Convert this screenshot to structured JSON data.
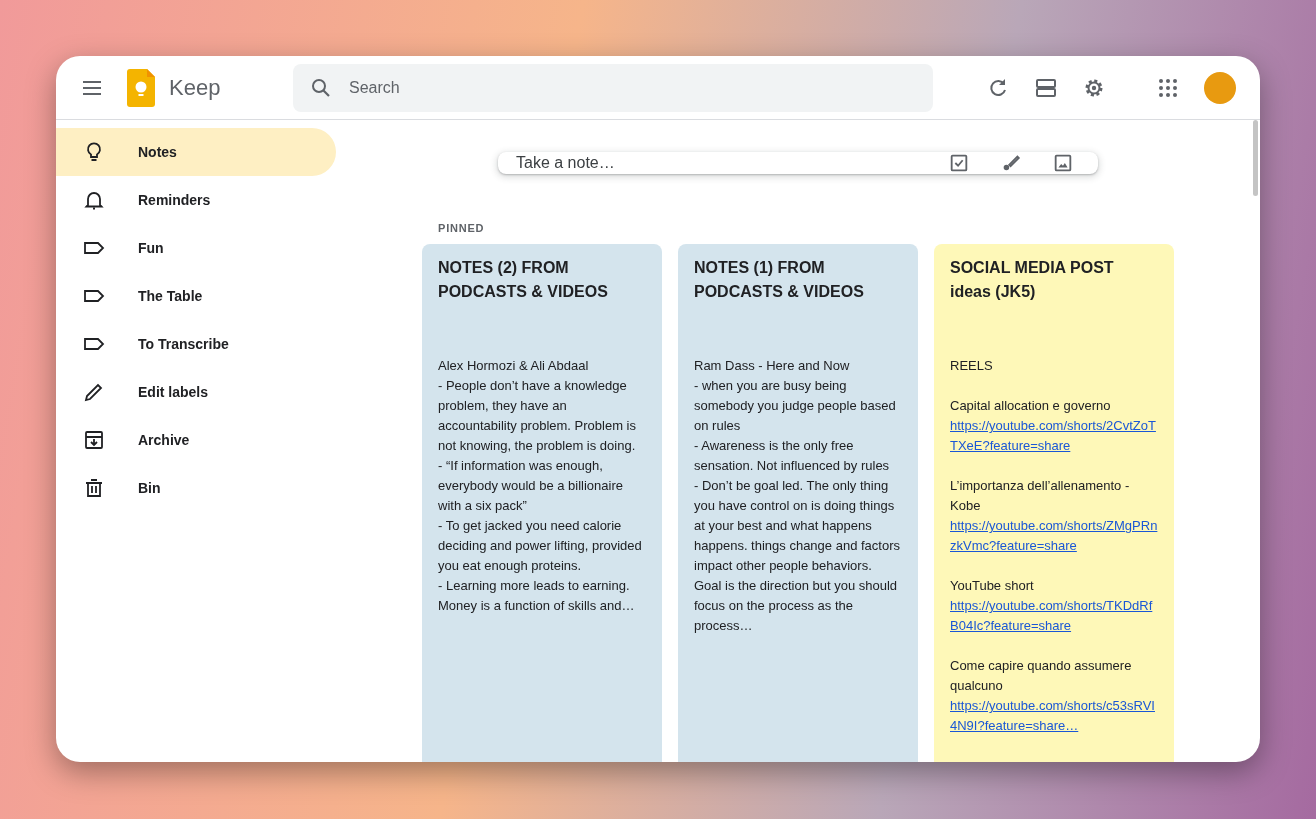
{
  "header": {
    "app_name": "Keep",
    "search": {
      "placeholder": "Search"
    }
  },
  "sidebar": {
    "items": [
      {
        "label": "Notes",
        "kind": "bulb",
        "selected": true
      },
      {
        "label": "Reminders",
        "kind": "bell",
        "selected": false
      },
      {
        "label": "Fun",
        "kind": "label",
        "selected": false
      },
      {
        "label": "The Table",
        "kind": "label",
        "selected": false
      },
      {
        "label": "To Transcribe",
        "kind": "label",
        "selected": false
      },
      {
        "label": "Edit labels",
        "kind": "pencil",
        "selected": false
      },
      {
        "label": "Archive",
        "kind": "archive",
        "selected": false
      },
      {
        "label": "Bin",
        "kind": "trash",
        "selected": false
      }
    ]
  },
  "take_note": {
    "placeholder": "Take a note…"
  },
  "pinned_label": "PINNED",
  "notes": [
    {
      "title": "NOTES (2) FROM PODCASTS & VIDEOS",
      "color": "#d4e4ed",
      "sections": [
        [
          {
            "kind": "text",
            "text": "Alex Hormozi & Ali Abdaal"
          },
          {
            "kind": "text",
            "text": "- People don’t have a knowledge problem, they have an accountability problem. Problem is not knowing, the problem is doing."
          },
          {
            "kind": "text",
            "text": "- “If information  was enough, everybody would be a billionaire with a six pack”"
          },
          {
            "kind": "text",
            "text": "- To get jacked you need calorie deciding and power lifting, provided you eat enough proteins."
          },
          {
            "kind": "text",
            "text": "- Learning more leads to earning. Money is a function of skills and…"
          }
        ]
      ]
    },
    {
      "title": "NOTES (1) FROM PODCASTS & VIDEOS",
      "color": "#d4e4ed",
      "sections": [
        [
          {
            "kind": "text",
            "text": "Ram Dass - Here and Now"
          },
          {
            "kind": "text",
            "text": "- when you are busy being somebody you judge people based on rules"
          },
          {
            "kind": "text",
            "text": "- Awareness is the only free sensation. Not influenced by rules"
          },
          {
            "kind": "text",
            "text": "- Don’t be goal led. The only thing you have control on is doing things at your best and what happens happens. things change and factors impact other people behaviors. Goal is the direction but you should focus on the process as the process…"
          }
        ]
      ]
    },
    {
      "title": "SOCIAL MEDIA POST ideas (JK5)",
      "color": "#fef8b8",
      "sections": [
        [
          {
            "kind": "text",
            "text": "REELS"
          }
        ],
        [
          {
            "kind": "text",
            "text": "Capital allocation e governo"
          },
          {
            "kind": "link",
            "text": "https://youtube.com/shorts/2CvtZoTTXeE?feature=share"
          }
        ],
        [
          {
            "kind": "text",
            "text": "L’importanza dell’allenamento - Kobe"
          },
          {
            "kind": "link",
            "text": "https://youtube.com/shorts/ZMgPRnzkVmc?feature=share"
          }
        ],
        [
          {
            "kind": "text",
            "text": "YouTube short"
          },
          {
            "kind": "link",
            "text": "https://youtube.com/shorts/TKDdRfB04Ic?feature=share"
          }
        ],
        [
          {
            "kind": "text",
            "text": "Come capire quando assumere qualcuno"
          },
          {
            "kind": "link",
            "text": "https://youtube.com/shorts/c53sRVI4N9I?feature=share…"
          }
        ]
      ]
    }
  ]
}
